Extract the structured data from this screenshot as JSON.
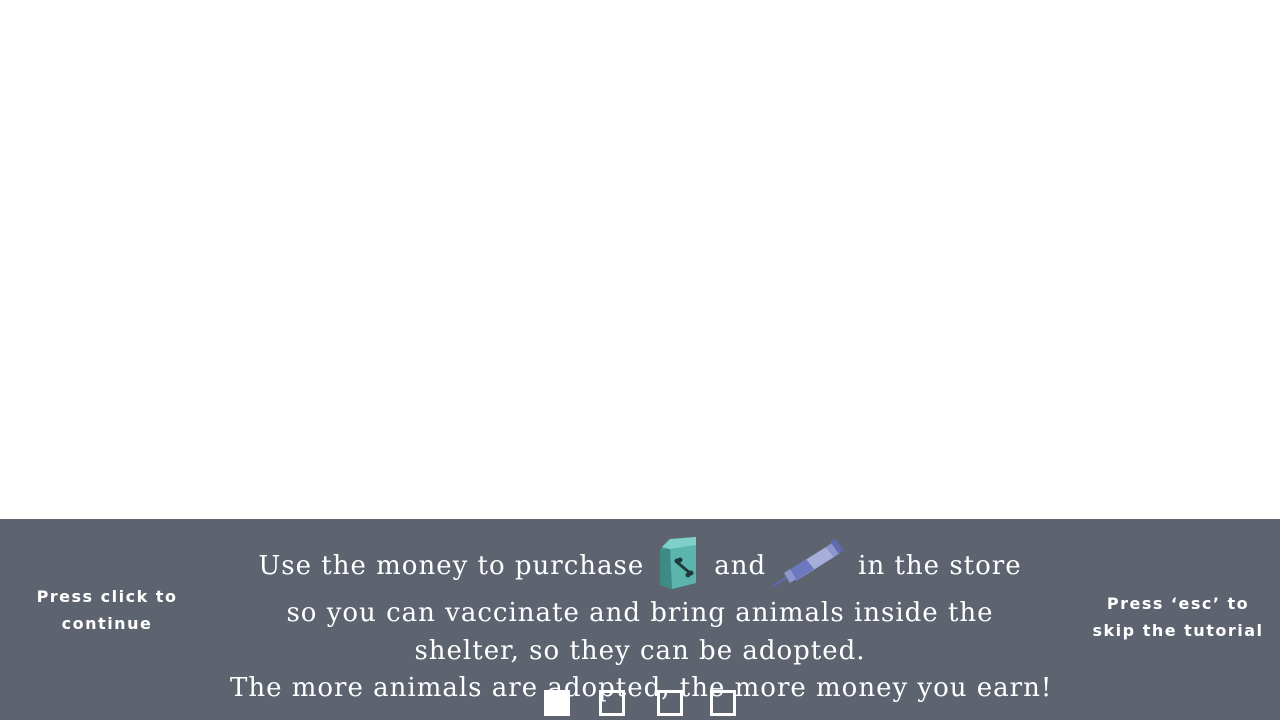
{
  "tutorial": {
    "continue_hint": "Press click to continue",
    "skip_hint": "Press ‘esc’ to skip the tutorial",
    "line1_part1": "Use the money to purchase",
    "line1_part2": "and",
    "line1_part3": "in the store",
    "line2": "so you can vaccinate and bring animals inside the",
    "line3": "shelter, so they can be adopted.",
    "line4": "The more animals are adopted, the more money you earn!",
    "icons": [
      "pet-food-bag-icon",
      "syringe-icon"
    ]
  },
  "pager": {
    "total_pages": 4,
    "current_page": 1
  },
  "colors": {
    "panel_background": "#5e6370",
    "text": "#ffffff",
    "food_bag": "#5cb5ad",
    "syringe": "#7f8cc8"
  }
}
